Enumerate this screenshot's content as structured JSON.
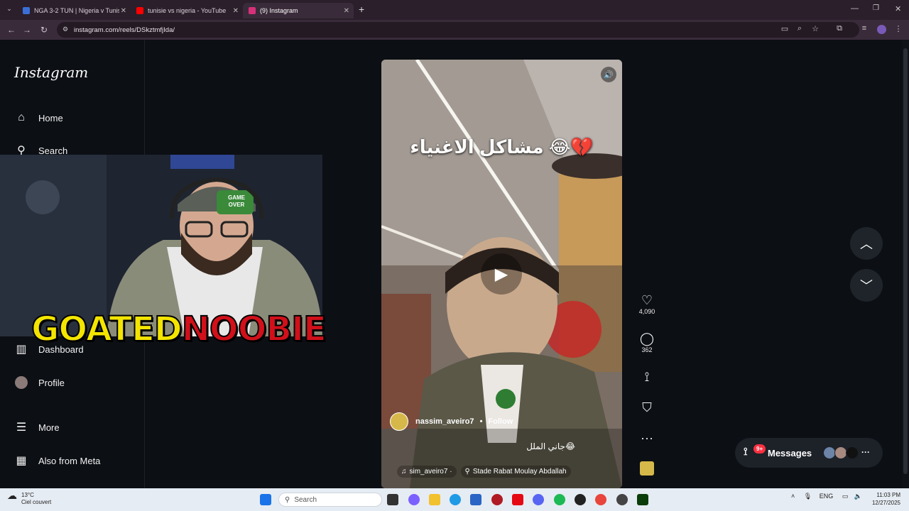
{
  "browser": {
    "tabs": [
      {
        "title": "NGA 3-2 TUN | Nigeria v Tunisi",
        "active": false,
        "favicon_color": "#3b6fd8"
      },
      {
        "title": "tunisie vs nigeria - YouTube",
        "active": false,
        "favicon_color": "#ff0000"
      },
      {
        "title": "(9) Instagram",
        "active": true,
        "favicon_color": "#d6307a"
      }
    ],
    "url": "instagram.com/reels/DSkztmfjIda/",
    "new_tab_symbol": "+"
  },
  "sidebar": {
    "logo": "Instagram",
    "items": [
      {
        "label": "Home",
        "icon": "home-icon"
      },
      {
        "label": "Search",
        "icon": "search-icon"
      },
      {
        "label": "Dashboard",
        "icon": "dashboard-icon"
      },
      {
        "label": "Profile",
        "icon": "avatar"
      },
      {
        "label": "More",
        "icon": "menu-icon"
      },
      {
        "label": "Also from Meta",
        "icon": "meta-apps-icon"
      }
    ]
  },
  "overlay": {
    "brand_part1": "GOATED",
    "brand_part2": "NOOBIE",
    "cap_text": "GAME OVER"
  },
  "reel": {
    "top_caption": "مشاكل الاغنياء 😂💔",
    "author": "nassim_aveiro7",
    "follow": "Follow",
    "separator": "•",
    "overlay_text": "جاني الملل😂",
    "audio": "sim_aveiro7 ·",
    "location": "Stade Rabat Moulay Abdallah"
  },
  "actions": {
    "likes": "4,090",
    "comments": "362",
    "more": "···"
  },
  "messages": {
    "label": "Messages",
    "badge": "9+"
  },
  "taskbar": {
    "weather_temp": "13°C",
    "weather_desc": "Ciel couvert",
    "search_placeholder": "Search",
    "lang": "ENG",
    "time": "11:03 PM",
    "date": "12/27/2025"
  }
}
